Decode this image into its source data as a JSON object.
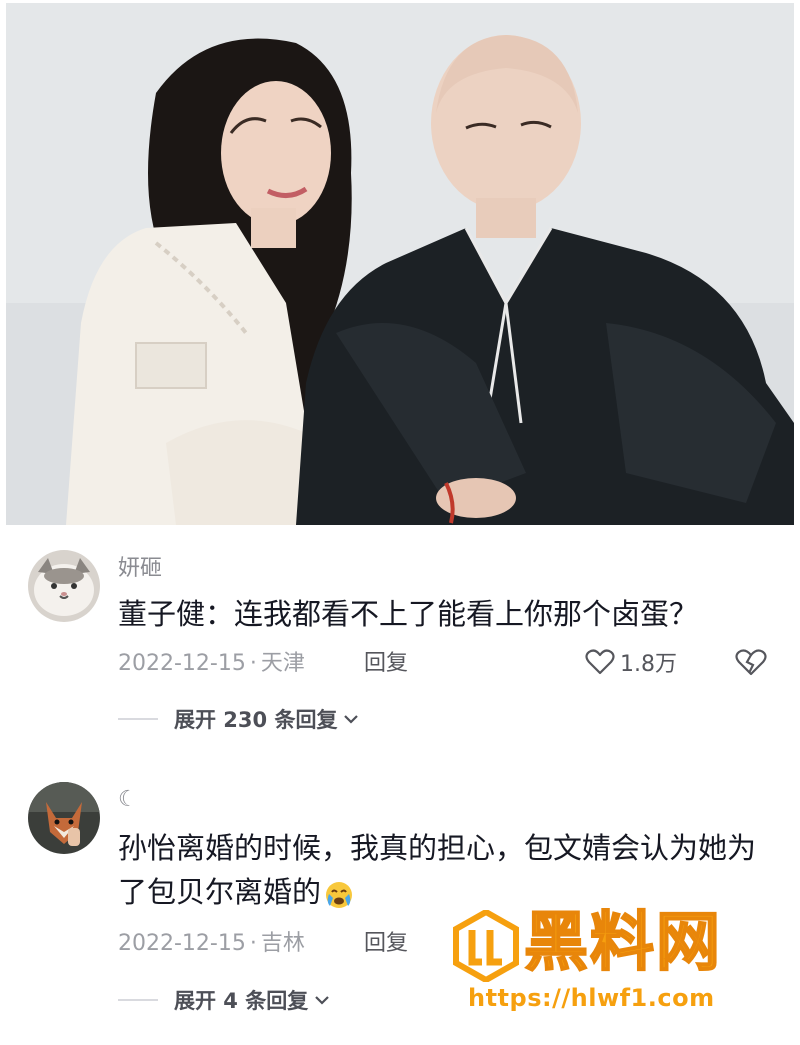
{
  "photo": {
    "description_icon": "couple-photo"
  },
  "comments": [
    {
      "username": "妍砸",
      "text": "董子健：连我都看不上了能看上你那个卤蛋？",
      "date": "2022-12-15",
      "location": "天津",
      "reply_label": "回复",
      "likes": "1.8万",
      "expand_label": "展开 230 条回复",
      "avatar_icon": "cat-avatar-icon"
    },
    {
      "username": "☾",
      "text_line1": "孙怡离婚的时候，我真的担心，包文婧会认为她为",
      "text_line2": "了包贝尔离婚的",
      "date": "2022-12-15",
      "location": "吉林",
      "reply_label": "回复",
      "expand_label": "展开 4 条回复",
      "avatar_icon": "fox-avatar-icon",
      "emoji_icon": "crying-face-emoji"
    }
  ],
  "watermark": {
    "title": "黑料网",
    "url": "https://hlwf1.com"
  },
  "colors": {
    "text_primary": "#161823",
    "text_secondary": "#9c9ea4",
    "watermark": "#f6a00f"
  }
}
